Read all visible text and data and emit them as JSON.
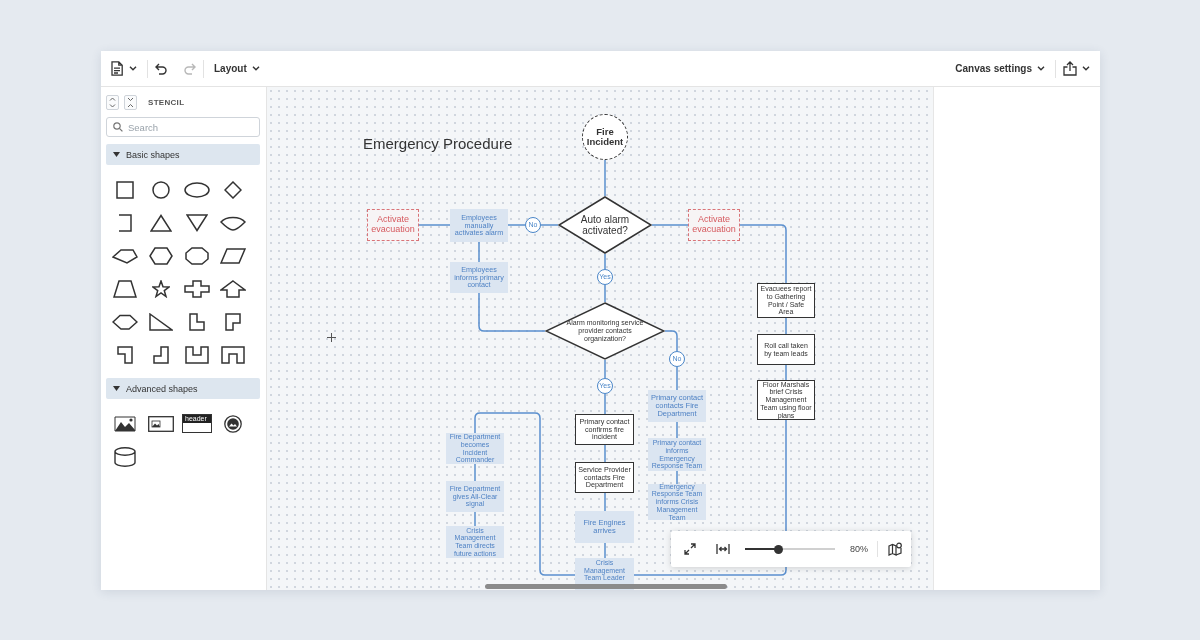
{
  "toolbar": {
    "history": [
      {
        "kind": "undo",
        "disabled": false
      },
      {
        "kind": "redo",
        "disabled": true
      }
    ],
    "layout_menu": {
      "label": "Layout"
    },
    "canvas_settings_menu": {
      "label": "Canvas settings"
    }
  },
  "stencil": {
    "title": "STENCIL",
    "search": {
      "placeholder": "Search"
    },
    "sections": [
      {
        "kind": "basic",
        "label": "Basic shapes",
        "expanded": true
      },
      {
        "kind": "advanced",
        "label": "Advanced shapes",
        "expanded": true,
        "header_card_label": "header"
      }
    ]
  },
  "diagram": {
    "title": "Emergency Procedure",
    "nodes": [
      {
        "kind": "start",
        "text": "Fire Incident"
      },
      {
        "kind": "alert",
        "text": "Activate evacuation"
      },
      {
        "kind": "action",
        "text": "Employees manually activates alarm"
      },
      {
        "kind": "label",
        "text": "No"
      },
      {
        "kind": "decision",
        "text": "Auto alarm activated?"
      },
      {
        "kind": "alert",
        "text": "Activate evacuation"
      },
      {
        "kind": "action",
        "text": "Employees informs primary contact"
      },
      {
        "kind": "label",
        "text": "Yes"
      },
      {
        "kind": "process",
        "text": "Evacuees report to Gathering Point / Safe Area"
      },
      {
        "kind": "decision",
        "text": "Alarm monitoring service provider contacts organization?"
      },
      {
        "kind": "label",
        "text": "No"
      },
      {
        "kind": "process",
        "text": "Roll call taken by team leads"
      },
      {
        "kind": "label",
        "text": "Yes"
      },
      {
        "kind": "action",
        "text": "Primary contact contacts Fire Department"
      },
      {
        "kind": "process",
        "text": "Floor Marshals brief Crisis Management Team using floor plans"
      },
      {
        "kind": "process",
        "text": "Primary contact confirms fire incident"
      },
      {
        "kind": "action",
        "text": "Fire Department becomes Incident Commander"
      },
      {
        "kind": "action",
        "text": "Primary contact informs Emergency Response Team"
      },
      {
        "kind": "process",
        "text": "Service Provider contacts Fire Department"
      },
      {
        "kind": "action",
        "text": "Fire Department gives All-Clear signal"
      },
      {
        "kind": "action",
        "text": "Emergency Response Team informs Crisis Management Team"
      },
      {
        "kind": "action",
        "text": "Crisis Management Team directs future actions"
      },
      {
        "kind": "action",
        "text": "Fire Engines arrives"
      },
      {
        "kind": "action",
        "text": "Crisis Management Team Leader"
      }
    ]
  },
  "zoom_bar": {
    "level": 0.37,
    "reading": "80%"
  }
}
